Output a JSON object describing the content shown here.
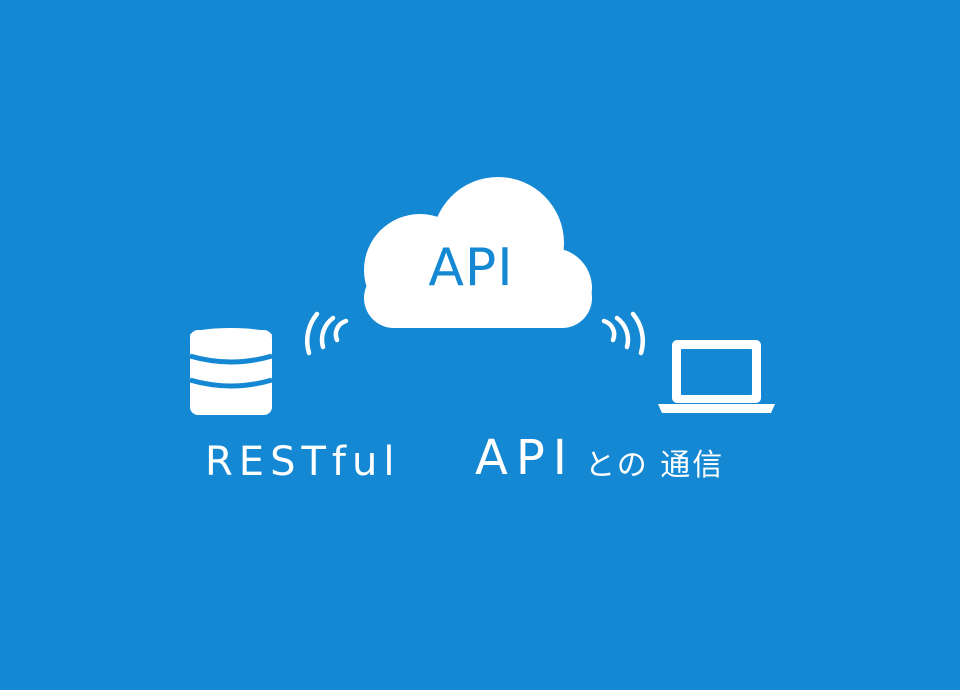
{
  "background_color": "#1588d4",
  "foreground_color": "#ffffff",
  "icons": {
    "cloud": "cloud-icon",
    "database": "database-icon",
    "laptop": "laptop-icon",
    "signal_left": "wireless-signal-icon",
    "signal_right": "wireless-signal-icon"
  },
  "cloud_label": "API",
  "caption": {
    "latin": "RESTful",
    "api": "API",
    "japanese": "との 通信"
  }
}
